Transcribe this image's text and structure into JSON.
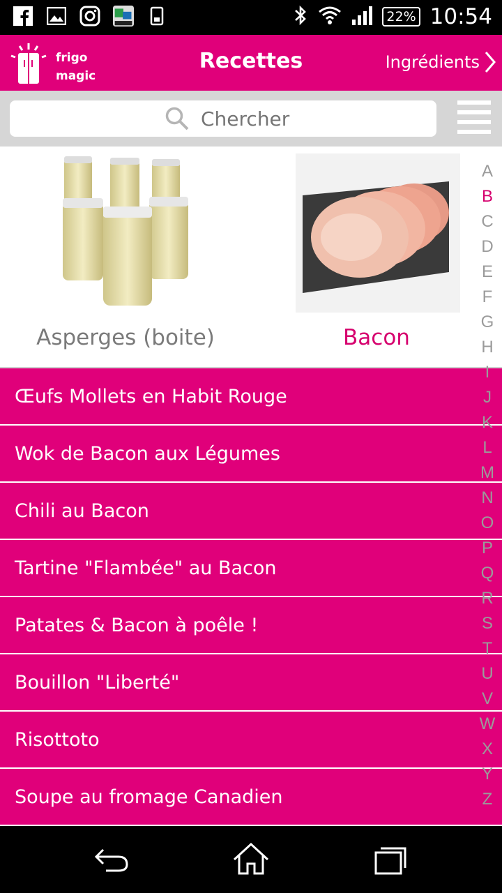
{
  "status_bar": {
    "battery": "22%",
    "time": "10:54",
    "left_icons": [
      "facebook-icon",
      "image-icon",
      "instagram-icon",
      "nikon-app-icon",
      "phone-icon"
    ],
    "right_icons": [
      "bluetooth-icon",
      "wifi-icon",
      "signal-icon",
      "battery-icon"
    ]
  },
  "header": {
    "logo_line1": "frigo",
    "logo_line2": "magic",
    "title": "Recettes",
    "ingredients_link": "Ingrédients"
  },
  "search": {
    "placeholder": "Chercher"
  },
  "ingredients": [
    {
      "label": "Asperges (boite)",
      "selected": false
    },
    {
      "label": "Bacon",
      "selected": true
    }
  ],
  "recipes": [
    "Œufs Mollets en Habit Rouge",
    "Wok de Bacon aux Légumes",
    "Chili au Bacon",
    "Tartine \"Flambée\" au Bacon",
    "Patates & Bacon à poêle !",
    "Bouillon \"Liberté\"",
    "Risottoto",
    "Soupe au fromage Canadien"
  ],
  "alphabet": [
    "A",
    "B",
    "C",
    "D",
    "E",
    "F",
    "G",
    "H",
    "I",
    "J",
    "K",
    "L",
    "M",
    "N",
    "O",
    "P",
    "Q",
    "R",
    "S",
    "T",
    "U",
    "V",
    "W",
    "X",
    "Y",
    "Z"
  ],
  "alphabet_active": "B",
  "colors": {
    "accent": "#e0007a",
    "selected_text": "#d6006e",
    "muted_text": "#7a7a7a"
  },
  "nav_icons": [
    "back-icon",
    "home-icon",
    "recents-icon"
  ]
}
